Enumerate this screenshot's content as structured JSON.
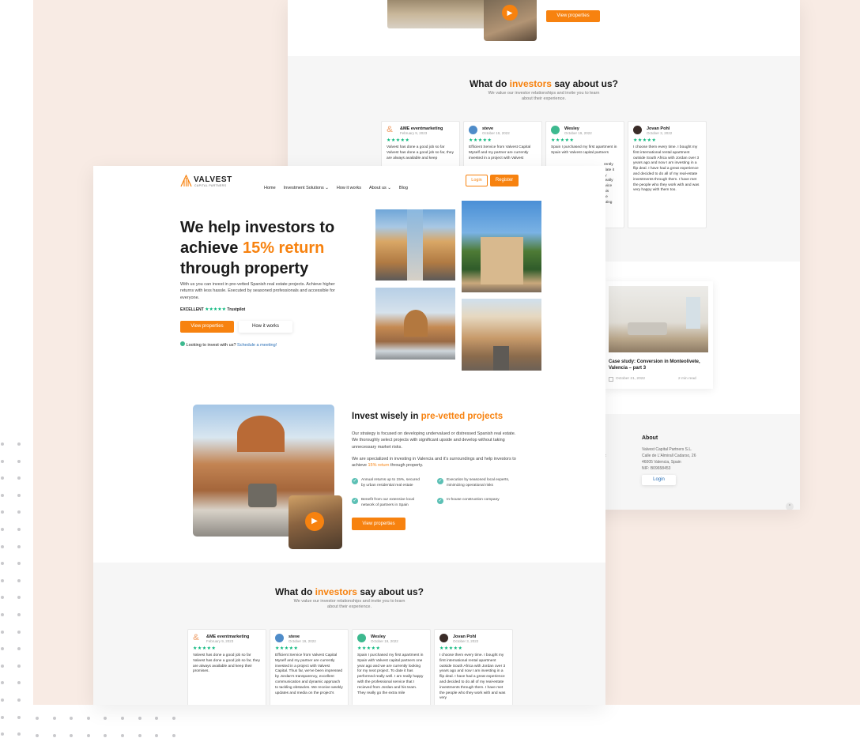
{
  "colors": {
    "accent": "#f7820f",
    "peach": "#f8ebe4",
    "trustpilot": "#04b67a",
    "check": "#5cc0b5"
  },
  "back": {
    "view_properties": "View properties",
    "reviews_title_a": "What do ",
    "reviews_title_b": "investors",
    "reviews_title_c": " say about us?",
    "reviews_sub_1": "We value our investor relationships and invite you to learn",
    "reviews_sub_2": "about their experience.",
    "reviews": [
      {
        "name": "&ME eventmarketing",
        "date": "February 9, 2023",
        "text": "Valvest has done a good job so far Valvest has done a good job so far, they are always available and keep"
      },
      {
        "name": "steve",
        "date": "October 19, 2022",
        "text": "Efficient Service from Valvest Capital Myself and my partner are currently invested in a project with Valvest"
      },
      {
        "name": "Wesley",
        "date": "October 19, 2022",
        "text": "Spain I purchased my first apartment in Spain with Valvest capital partners"
      },
      {
        "name": "Jovan Pohl",
        "date": "October 3, 2022",
        "text": "I choose them every time. I bought my first international rental apartment outside South Africa with Jordan over 3 years ago and now I am investing in a flip deal. I have had a great experience and decided to do all of my real-estate investments through them. I have met the people who they work with and was very happy with them too."
      }
    ],
    "review_fragments": [
      "rently",
      "date it",
      "ly",
      "really",
      "rvice",
      "his",
      "ile",
      "ating"
    ],
    "blog_title": "Case study: Conversion in Monteolivete, Valencia – part 3",
    "blog_date": "October 21, 2022",
    "blog_read": "2 min read",
    "about_heading": "About",
    "about_lines": [
      "Valvest Capital Partners S.L.",
      "Calle de L'Almirall Cadarso, 26",
      "46005 Valencia, Spain",
      "NIF: B09658453"
    ],
    "about_login": "Login",
    "scroll_marker": "^",
    "edge_marker": "‹"
  },
  "front": {
    "logo": "VALVEST",
    "logo_sub": "CAPITAL PARTNERS",
    "nav": [
      "Home",
      "Investment Solutions",
      "How it works",
      "About us",
      "Blog"
    ],
    "login": "Login",
    "register": "Register",
    "hero_l1": "We help investors to",
    "hero_l2a": "achieve ",
    "hero_l2b": "15% return",
    "hero_l3": "through property",
    "hero_desc": "With us you can invest in pre-vetted Spanish real estate projects. Achieve higher returns with less hassle. Executed by seasoned professionals and accessible for everyone.",
    "trust_excellent": "EXCELLENT",
    "trust_stars": "★★★★★",
    "trust_brand": "Trustpilot",
    "view_properties": "View properties",
    "how_it_works": "How it works",
    "looking": "Looking to invest with us?",
    "schedule": "Schedule a meeting!",
    "invest_a": "Invest wisely in ",
    "invest_b": "pre-vetted projects",
    "invest_p1": "Our strategy is focused on developing undervalued or distressed Spanish real estate. We thoroughly select projects with significant upside and develop without taking unnecessary market risks.",
    "invest_p2a": "We are specialized in investing in Valencia and it's surroundings and help investors to achieve ",
    "invest_p2b": "15% return",
    "invest_p2c": " through property.",
    "features": [
      "Annual returns up to 15%, secured by urban residential real estate",
      "Execution by seasoned local experts, minimizing operational risks",
      "Benefit from our extensive local network of partners in Spain",
      "In-house construction company"
    ],
    "reviews_title_a": "What do ",
    "reviews_title_b": "investors",
    "reviews_title_c": " say about us?",
    "reviews_sub_1": "We value our investor relationships and invite you to learn",
    "reviews_sub_2": "about their experience.",
    "reviews": [
      {
        "name": "&ME eventmarketing",
        "date": "February 9, 2023",
        "text": "Valvest has done a good job so far Valvest has done a good job so far, they are always available and keep their promises."
      },
      {
        "name": "steve",
        "date": "October 19, 2022",
        "text": "Efficient Service from Valvest Capital Myself and my partner are currently invested in a project with Valvest Capital. Thus far, we've been impressed by Jordan's transparency, excellent communication and dynamic approach to tackling obstacles. We receive weekly updates and media on the project's"
      },
      {
        "name": "Wesley",
        "date": "October 19, 2022",
        "text": "Spain I purchased my first apartment in Spain with Valvest capital partners one year ago and we are currently looking for my next project. To date it has performed really well. I am really happy with the professional service that I recieved from Jordan and his team. They really go the extra mile"
      },
      {
        "name": "Jovan Pohl",
        "date": "October 3, 2022",
        "text": "I choose them every time. I bought my first international rental apartment outside South Africa with Jordan over 3 years ago and now I am investing in a flip deal. I have had a great experience and decided to do all of my real-estate investments through them. I have met the people who they work with and was very"
      }
    ]
  }
}
